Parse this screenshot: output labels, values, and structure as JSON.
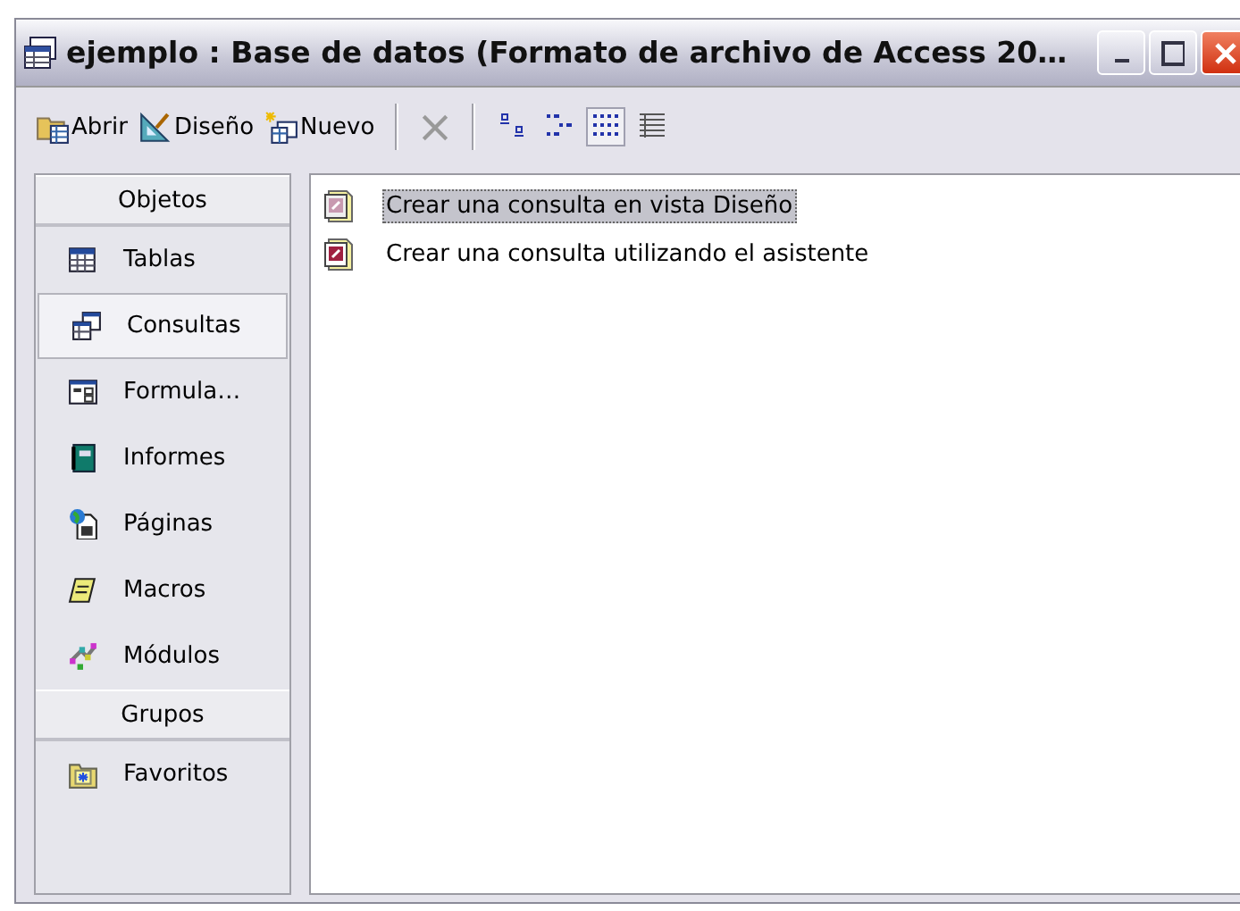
{
  "window": {
    "title": "ejemplo : Base de datos (Formato de archivo de Access 20…"
  },
  "toolbar": {
    "commands": [
      {
        "label": "Abrir",
        "disabled": false
      },
      {
        "label": "Diseño",
        "disabled": false
      },
      {
        "label": "Nuevo",
        "disabled": false
      },
      {
        "kind": "delete",
        "disabled": true
      }
    ],
    "views": [
      {
        "selected": false
      },
      {
        "selected": false
      },
      {
        "selected": true
      },
      {
        "selected": false
      }
    ]
  },
  "sidebar": {
    "sections": [
      {
        "header": "Objetos",
        "items": [
          {
            "label": "Tablas",
            "selected": false
          },
          {
            "label": "Consultas",
            "selected": true
          },
          {
            "label": "Formula…",
            "selected": false
          },
          {
            "label": "Informes",
            "selected": false
          },
          {
            "label": "Páginas",
            "selected": false
          },
          {
            "label": "Macros",
            "selected": false
          },
          {
            "label": "Módulos",
            "selected": false
          }
        ]
      },
      {
        "header": "Grupos",
        "items": [
          {
            "label": "Favoritos",
            "selected": false
          }
        ]
      }
    ]
  },
  "list": {
    "items": [
      {
        "label": "Crear una consulta en vista Diseño",
        "selected": true
      },
      {
        "label": "Crear una consulta utilizando el asistente",
        "selected": false
      }
    ]
  }
}
